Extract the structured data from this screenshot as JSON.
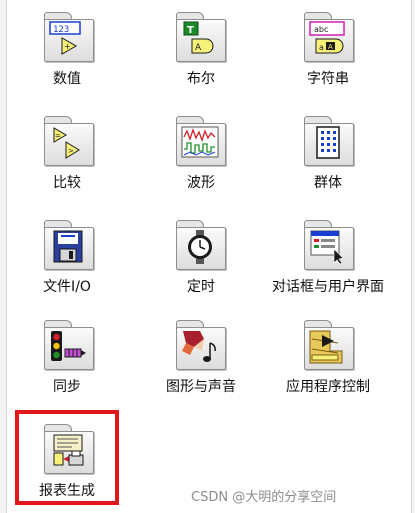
{
  "palette": {
    "items": [
      {
        "label": "数值",
        "icon": "numeric-icon"
      },
      {
        "label": "布尔",
        "icon": "boolean-icon"
      },
      {
        "label": "字符串",
        "icon": "string-icon"
      },
      {
        "label": "比较",
        "icon": "comparison-icon"
      },
      {
        "label": "波形",
        "icon": "waveform-icon"
      },
      {
        "label": "群体",
        "icon": "cluster-icon"
      },
      {
        "label": "文件I/O",
        "icon": "file-io-icon"
      },
      {
        "label": "定时",
        "icon": "timing-icon"
      },
      {
        "label": "对话框与用户界面",
        "icon": "dialog-ui-icon"
      },
      {
        "label": "同步",
        "icon": "synchronization-icon"
      },
      {
        "label": "图形与声音",
        "icon": "graphics-sound-icon"
      },
      {
        "label": "应用程序控制",
        "icon": "application-control-icon"
      },
      {
        "label": "报表生成",
        "icon": "report-generation-icon"
      }
    ]
  },
  "highlight_color": "#e2171b",
  "watermark": "CSDN @大明的分享空间"
}
